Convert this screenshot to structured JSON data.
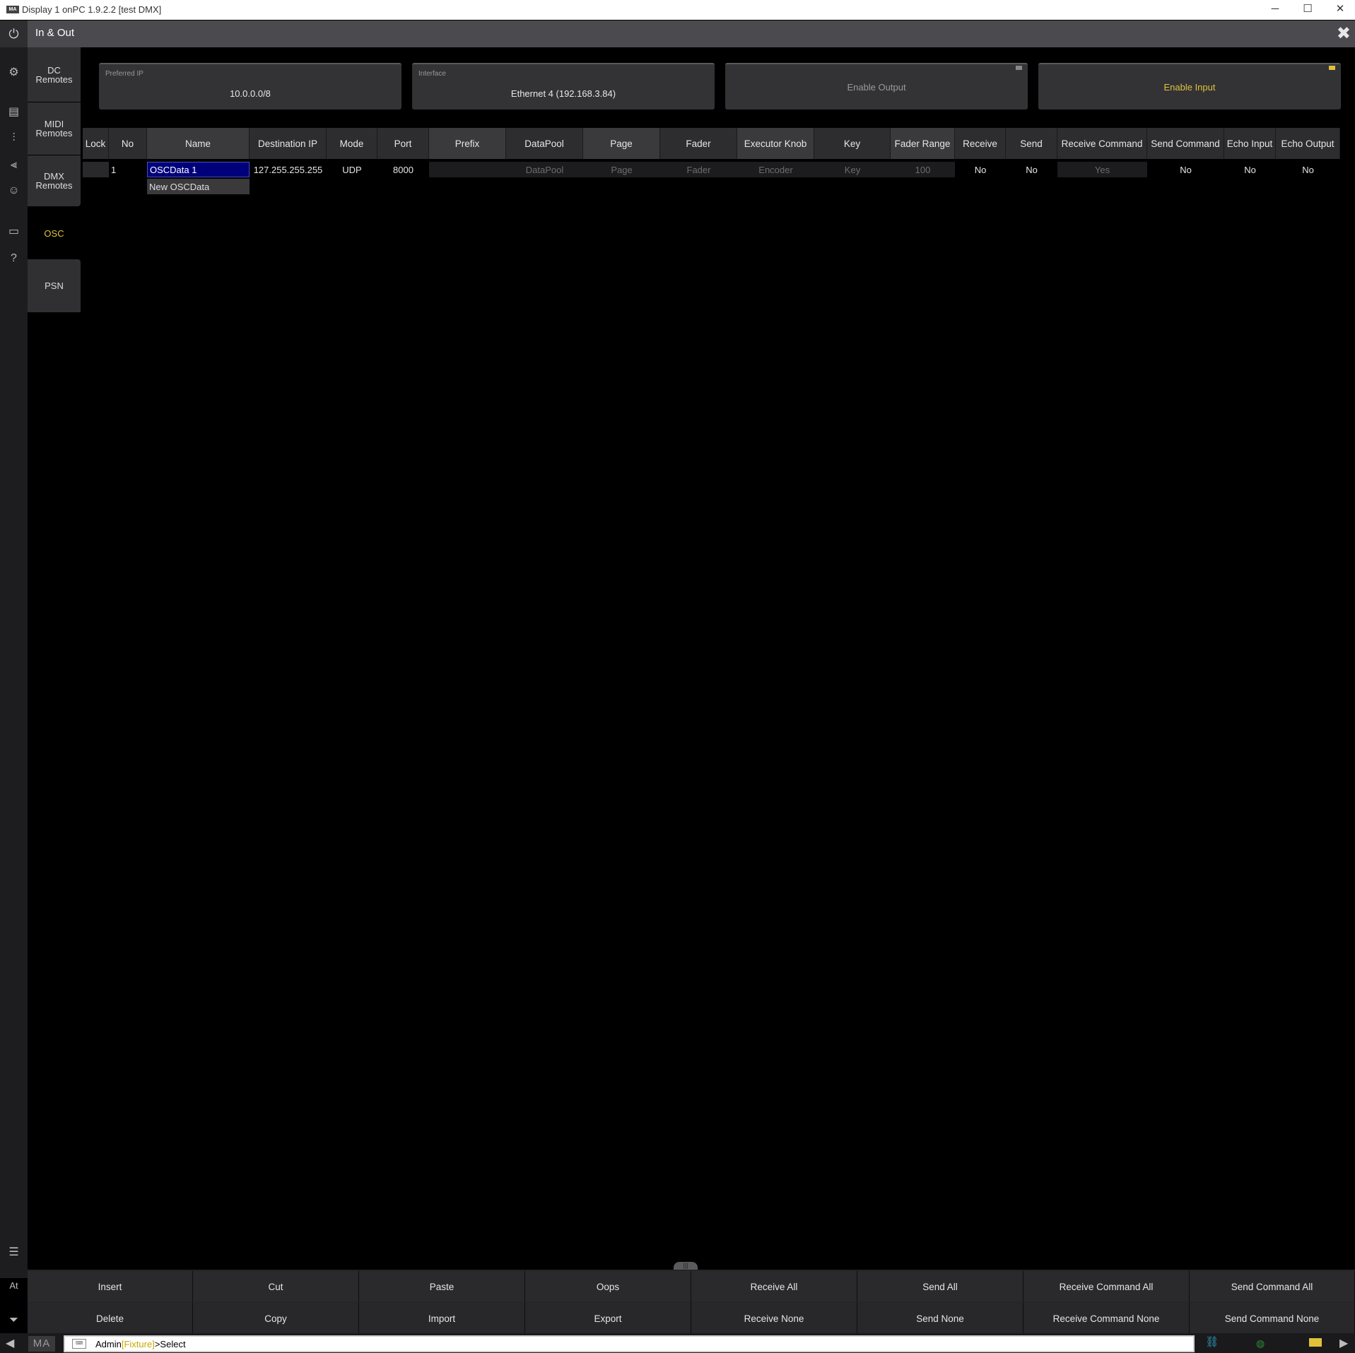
{
  "window": {
    "title": "Display 1 onPC 1.9.2.2 [test DMX]",
    "app_icon": "MA",
    "minimize_glyph": "─",
    "maximize_glyph": "☐",
    "close_glyph": "✕"
  },
  "header": {
    "title": "In & Out",
    "power_glyph": "⏻",
    "close_glyph": "✖"
  },
  "tabs": [
    {
      "label": "DC\nRemotes"
    },
    {
      "label": "MIDI\nRemotes"
    },
    {
      "label": "DMX\nRemotes"
    },
    {
      "label": "OSC"
    },
    {
      "label": "PSN"
    }
  ],
  "rail_icons": {
    "settings": "⚙",
    "book": "▤",
    "faders": "⫶",
    "mixer": "⫷",
    "user": "☺",
    "display": "▭",
    "help": "?",
    "list": "☰",
    "at": "At",
    "filter": "⏷"
  },
  "settings": {
    "preferred_ip": {
      "label": "Preferred IP",
      "value": "10.0.0.0/8"
    },
    "interface": {
      "label": "Interface",
      "value": "Ethernet 4 (192.168.3.84)"
    },
    "enable_output": "Enable Output",
    "enable_input": "Enable Input"
  },
  "table": {
    "columns": [
      "Lock",
      "No",
      "Name",
      "Destination IP",
      "Mode",
      "Port",
      "Prefix",
      "DataPool",
      "Page",
      "Fader",
      "Executor Knob",
      "Key",
      "Fader Range",
      "Receive",
      "Send",
      "Receive Command",
      "Send Command",
      "Echo Input",
      "Echo Output"
    ],
    "rows": [
      {
        "lock": "",
        "no": "1",
        "name": "OSCData 1",
        "destination_ip": "127.255.255.255",
        "mode": "UDP",
        "port": "8000",
        "prefix": "",
        "datapool": "DataPool",
        "page": "Page",
        "fader": "Fader",
        "executor_knob": "Encoder",
        "key": "Key",
        "fader_range": "100",
        "receive": "No",
        "send": "No",
        "receive_command": "Yes",
        "send_command": "No",
        "echo_input": "No",
        "echo_output": "No"
      }
    ],
    "new_row_label": "New OSCData"
  },
  "function_bar": {
    "row1": [
      "Insert",
      "Cut",
      "Paste",
      "Oops",
      "Receive All",
      "Send All",
      "Receive Command All",
      "Send Command All"
    ],
    "row2": [
      "Delete",
      "Copy",
      "Import",
      "Export",
      "Receive None",
      "Send None",
      "Receive Command None",
      "Send Command None"
    ],
    "handle_glyph": "|||"
  },
  "command_line": {
    "user": "Admin",
    "context": "[Fixture]",
    "prompt": ">Select",
    "logo": "MA",
    "left_arrow": "◀",
    "right_arrow": "▶"
  },
  "colors": {
    "accent_yellow": "#e0c23a",
    "selection_blue": "#00007a"
  }
}
